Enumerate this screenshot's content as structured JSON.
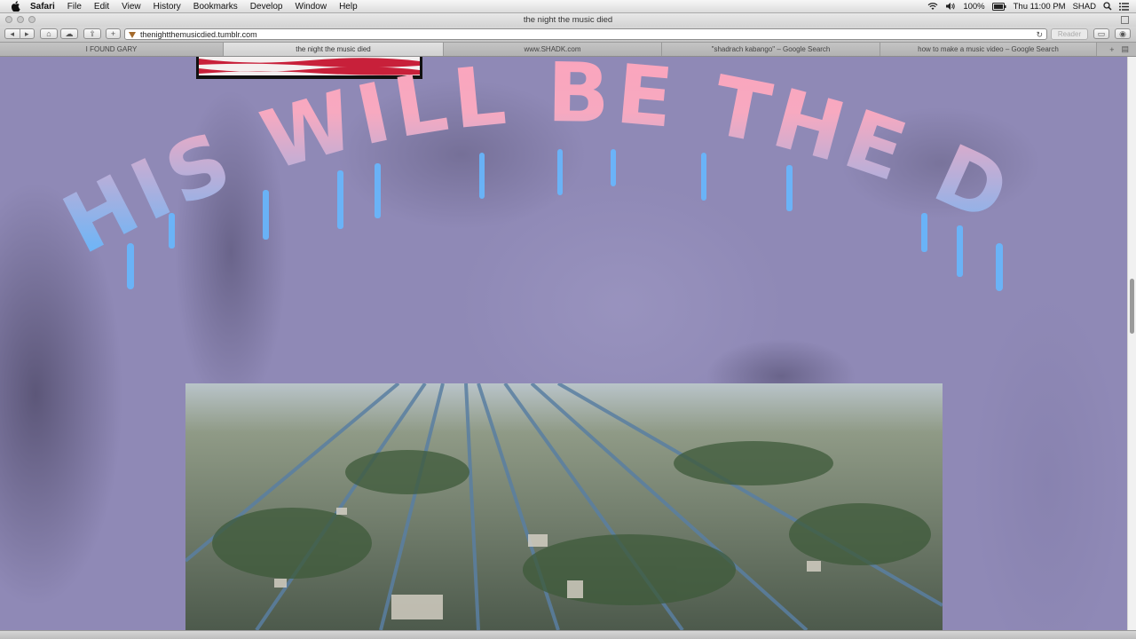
{
  "menubar": {
    "app": "Safari",
    "items": [
      "File",
      "Edit",
      "View",
      "History",
      "Bookmarks",
      "Develop",
      "Window",
      "Help"
    ],
    "battery": "100%",
    "clock": "Thu 11:00 PM",
    "user": "SHAD"
  },
  "window": {
    "title": "the night the music died"
  },
  "toolbar": {
    "url": "thenightthemusicdied.tumblr.com",
    "reader_label": "Reader"
  },
  "tabs": [
    {
      "label": "I FOUND GARY",
      "active": false
    },
    {
      "label": "the night the music died",
      "active": true
    },
    {
      "label": "www.SHADK.com",
      "active": false
    },
    {
      "label": "\"shadrach kabango\" – Google Search",
      "active": false
    },
    {
      "label": "how to make a music video – Google Search",
      "active": false
    }
  ],
  "page": {
    "headline": "THIS WILL BE THE DAY",
    "photo_desc": "flooded-neighborhood-aerial"
  },
  "colors": {
    "background": "#8f89b6",
    "headline_top": "#ff9fb8",
    "headline_bottom": "#58b7ff"
  }
}
